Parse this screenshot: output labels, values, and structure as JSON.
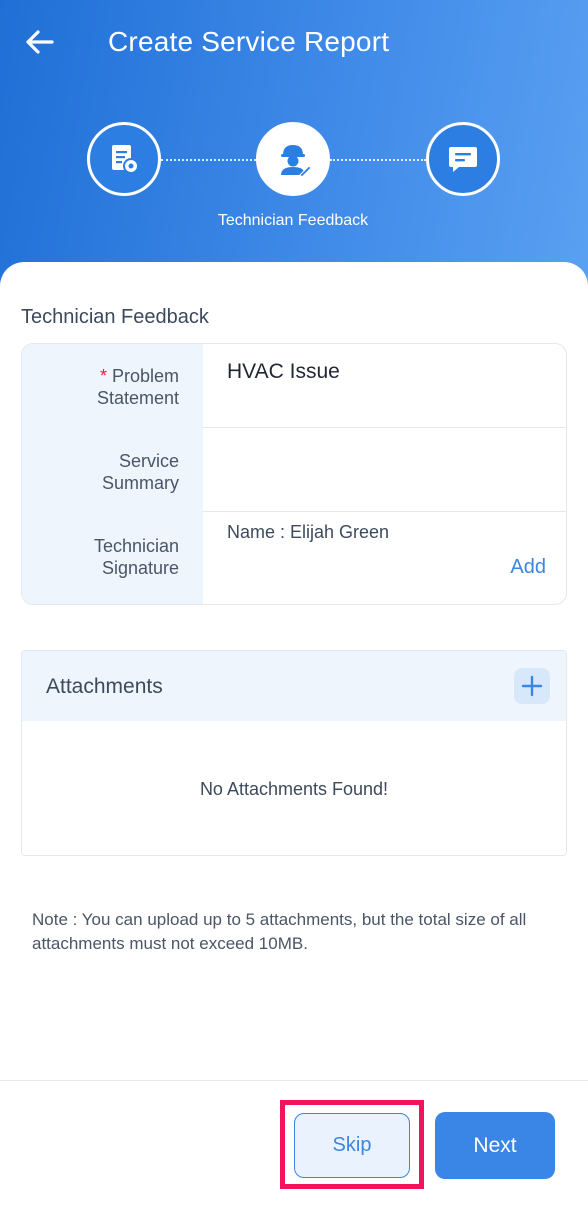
{
  "header": {
    "title": "Create Service Report",
    "back_icon": "arrow-left-icon"
  },
  "stepper": {
    "steps": [
      {
        "icon": "document-settings-icon",
        "state": "inactive"
      },
      {
        "icon": "technician-icon",
        "state": "active",
        "label": "Technician Feedback"
      },
      {
        "icon": "chat-message-icon",
        "state": "inactive"
      }
    ],
    "active_label": "Technician Feedback"
  },
  "form": {
    "section_title": "Technician Feedback",
    "rows": [
      {
        "required_mark": "*",
        "label_line1": "Problem",
        "label_line2": "Statement",
        "value": "HVAC Issue"
      },
      {
        "label_line1": "Service",
        "label_line2": "Summary",
        "value": ""
      },
      {
        "label_line1": "Technician",
        "label_line2": "Signature",
        "name_text": "Name : Elijah Green",
        "action": "Add"
      }
    ]
  },
  "attachments": {
    "title": "Attachments",
    "empty_text": "No Attachments Found!",
    "add_icon": "plus-icon"
  },
  "note": "Note : You can upload up to 5 attachments, but the total size of all attachments must not exceed 10MB.",
  "footer": {
    "skip_label": "Skip",
    "next_label": "Next"
  },
  "colors": {
    "header_gradient_start": "#1f6fd6",
    "header_gradient_end": "#5aa0f2",
    "accent": "#3a86e0",
    "required": "#e0223a",
    "highlight": "#f0145a"
  }
}
